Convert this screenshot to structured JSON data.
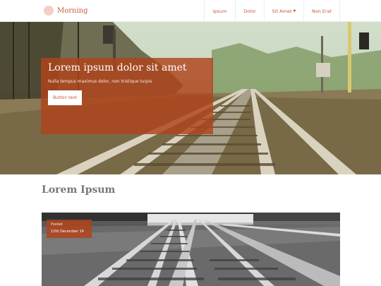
{
  "header": {
    "brand": "Morning",
    "nav": [
      {
        "label": "Ipsum"
      },
      {
        "label": "Dolor"
      },
      {
        "label": "Sit Amet",
        "has_dropdown": true
      },
      {
        "label": "Non Erat"
      }
    ]
  },
  "hero": {
    "title": "Lorem ipsum dolor sit amet",
    "subtitle": "Nulla tempus maximus dolor, non tristique turpis",
    "button_label": "Button text"
  },
  "section": {
    "title": "Lorem Ipsum"
  },
  "post": {
    "meta_label": "Posted",
    "meta_date": "12th December 14"
  },
  "colors": {
    "accent": "#c55a3a",
    "overlay": "#b0431b",
    "logo": "#f3cfc6"
  },
  "icons": {
    "logo": "circle-logo-icon",
    "dropdown": "caret-down-icon"
  }
}
